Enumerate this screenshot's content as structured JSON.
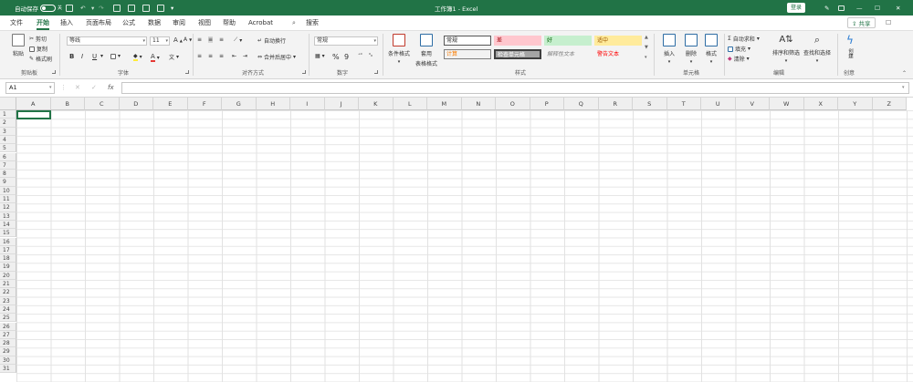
{
  "titlebar": {
    "autosave_label": "自动保存",
    "autosave_state": "关",
    "doc_title": "工作簿1 - Excel",
    "signin_label": "登录",
    "min_symbol": "—",
    "max_symbol": "☐",
    "close_symbol": "✕"
  },
  "tabs": [
    "文件",
    "开始",
    "插入",
    "页面布局",
    "公式",
    "数据",
    "审阅",
    "视图",
    "帮助",
    "Acrobat"
  ],
  "active_tab": "开始",
  "search_label": "搜索",
  "share_label": "共享",
  "ribbon": {
    "clipboard": {
      "paste": "粘贴",
      "cut": "剪切",
      "copy": "复制",
      "format_painter": "格式刷",
      "label": "剪贴板"
    },
    "font": {
      "name": "等线",
      "size": "11",
      "label": "字体",
      "bold": "B",
      "italic": "I",
      "underline": "U"
    },
    "alignment": {
      "wrap": "自动换行",
      "merge": "合并后居中",
      "label": "对齐方式"
    },
    "number": {
      "format": "常规",
      "percent": "%",
      "comma": "9",
      "label": "数字"
    },
    "styles": {
      "conditional": "条件格式",
      "table_format_line1": "套用",
      "table_format_line2": "表格格式",
      "cells": [
        "常规",
        "差",
        "好",
        "适中",
        "计算",
        "检查单元格",
        "解释性文本",
        "警告文本"
      ],
      "label": "样式"
    },
    "cells_group": {
      "insert": "插入",
      "delete": "删除",
      "format": "格式",
      "label": "单元格"
    },
    "editing": {
      "autosum": "自动求和",
      "fill": "填充",
      "clear": "清除",
      "sort": "排序和筛选",
      "find": "查找和选择",
      "label": "编辑"
    },
    "create": {
      "button": "创建",
      "label": "创意"
    }
  },
  "formula_bar": {
    "name_box": "A1",
    "fx": "fx",
    "cancel": "✕",
    "enter": "✓"
  },
  "columns": [
    "A",
    "B",
    "C",
    "D",
    "E",
    "F",
    "G",
    "H",
    "I",
    "J",
    "K",
    "L",
    "M",
    "N",
    "O",
    "P",
    "Q",
    "R",
    "S",
    "T",
    "U",
    "V",
    "W",
    "X",
    "Y",
    "Z"
  ],
  "rows": [
    "1",
    "2",
    "3",
    "4",
    "5",
    "6",
    "7",
    "8",
    "9",
    "10",
    "11",
    "12",
    "13",
    "14",
    "15",
    "16",
    "17",
    "18",
    "19",
    "20",
    "21",
    "22",
    "23",
    "24",
    "25",
    "26",
    "27",
    "28",
    "29",
    "30",
    "31"
  ],
  "colors": {
    "accent": "#217346",
    "bad_bg": "#ffc7ce",
    "good_bg": "#c6efce",
    "neutral_bg": "#ffeb9c",
    "check_bg": "#a5a5a5"
  }
}
